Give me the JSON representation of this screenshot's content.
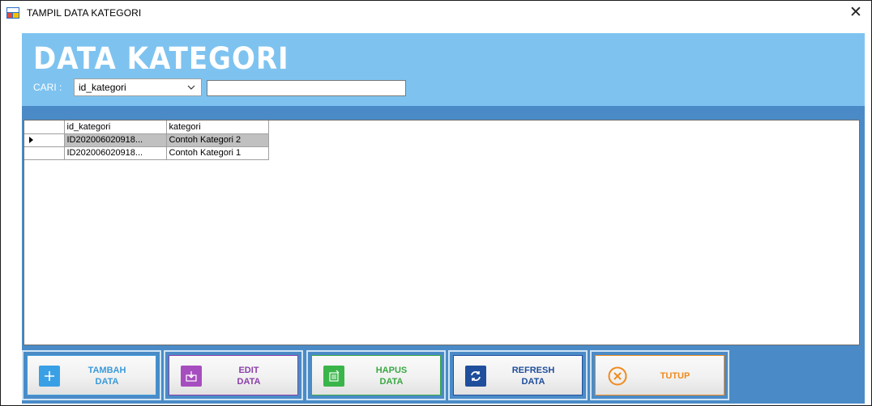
{
  "window": {
    "title": "TAMPIL DATA KATEGORI",
    "close_glyph": "✕"
  },
  "header": {
    "title": "DATA KATEGORI",
    "search_label": "CARI :",
    "search_select_value": "id_kategori",
    "search_input_value": ""
  },
  "grid": {
    "columns": [
      "id_kategori",
      "kategori"
    ],
    "rows": [
      [
        "ID202006020918...",
        "Contoh Kategori 2"
      ],
      [
        "ID202006020918...",
        "Contoh Kategori 1"
      ]
    ]
  },
  "buttons": [
    {
      "line1": "TAMBAH",
      "line2": "DATA",
      "icon": "plus-icon",
      "color": "#3aa0e6",
      "text_color": "#3a9ad9",
      "border": "#3a9ad9"
    },
    {
      "line1": "EDIT",
      "line2": "DATA",
      "icon": "edit-icon",
      "color": "#a64dbf",
      "text_color": "#8a3fa8",
      "border": "#8a3fa8"
    },
    {
      "line1": "HAPUS",
      "line2": "DATA",
      "icon": "delete-icon",
      "color": "#3ab54a",
      "text_color": "#3aa843",
      "border": "#3aa843"
    },
    {
      "line1": "REFRESH",
      "line2": "DATA",
      "icon": "refresh-icon",
      "color": "#1f4e9c",
      "text_color": "#1f4e9c",
      "border": "#1f4e9c"
    },
    {
      "line1": "TUTUP",
      "line2": "",
      "icon": "close-circle-icon",
      "color": "#f08a1c",
      "text_color": "#f08a1c",
      "border": "#f08a1c"
    }
  ],
  "colors": {
    "header_bg": "#7ec3f0",
    "panel_bg": "#4a8bc7",
    "selected_row": "#c0c0c0"
  }
}
